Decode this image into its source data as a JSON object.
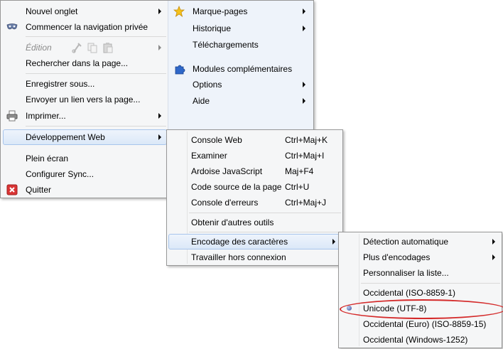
{
  "main_menu": {
    "left": [
      {
        "label": "Nouvel onglet",
        "arrow": true
      },
      {
        "label": "Commencer la navigation privée",
        "icon": "mask-icon"
      },
      {
        "label": "Édition",
        "disabled": true,
        "arrow": true,
        "edit_icons": [
          "cut-icon",
          "copy-icon",
          "paste-icon"
        ]
      },
      {
        "label": "Rechercher dans la page..."
      },
      {
        "label": "Enregistrer sous..."
      },
      {
        "label": "Envoyer un lien vers la page..."
      },
      {
        "label": "Imprimer...",
        "icon": "printer-icon",
        "arrow": true
      },
      {
        "label": "Développement Web",
        "arrow": true,
        "highlighted": true
      },
      {
        "label": "Plein écran"
      },
      {
        "label": "Configurer Sync..."
      },
      {
        "label": "Quitter",
        "icon": "quit-icon"
      }
    ],
    "right": [
      {
        "label": "Marque-pages",
        "icon": "star-icon",
        "arrow": true
      },
      {
        "label": "Historique",
        "arrow": true
      },
      {
        "label": "Téléchargements"
      },
      {
        "label": "Modules complémentaires",
        "icon": "puzzle-icon"
      },
      {
        "label": "Options",
        "arrow": true
      },
      {
        "label": "Aide",
        "arrow": true
      }
    ]
  },
  "dev_menu": [
    {
      "label": "Console Web",
      "shortcut": "Ctrl+Maj+K"
    },
    {
      "label": "Examiner",
      "shortcut": "Ctrl+Maj+I"
    },
    {
      "label": "Ardoise JavaScript",
      "shortcut": "Maj+F4"
    },
    {
      "label": "Code source de la page",
      "shortcut": "Ctrl+U"
    },
    {
      "label": "Console d'erreurs",
      "shortcut": "Ctrl+Maj+J"
    },
    {
      "label": "Obtenir d'autres outils"
    },
    {
      "label": "Encodage des caractères",
      "arrow": true,
      "highlighted": true
    },
    {
      "label": "Travailler hors connexion"
    }
  ],
  "encoding_menu": [
    {
      "label": "Détection automatique",
      "arrow": true
    },
    {
      "label": "Plus d'encodages",
      "arrow": true
    },
    {
      "label": "Personnaliser la liste..."
    },
    {
      "label": "Occidental (ISO-8859-1)"
    },
    {
      "label": "Unicode (UTF-8)",
      "selected": true
    },
    {
      "label": "Occidental (Euro) (ISO-8859-15)"
    },
    {
      "label": "Occidental (Windows-1252)"
    }
  ],
  "colors": {
    "highlight_border": "#a8c5ec",
    "annotation": "#d42a2a",
    "menu_bg": "#f5f6f7"
  }
}
